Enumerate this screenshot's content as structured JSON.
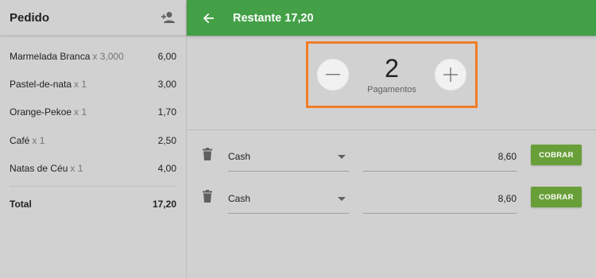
{
  "order": {
    "title": "Pedido",
    "items": [
      {
        "name": "Marmelada Branca",
        "qty": "x 3,000",
        "price": "6,00"
      },
      {
        "name": "Pastel-de-nata",
        "qty": "x 1",
        "price": "3,00"
      },
      {
        "name": "Orange-Pekoe",
        "qty": "x 1",
        "price": "1,70"
      },
      {
        "name": "Café",
        "qty": "x 1",
        "price": "2,50"
      },
      {
        "name": "Natas de Céu",
        "qty": "x 1",
        "price": "4,00"
      }
    ],
    "total_label": "Total",
    "total_value": "17,20"
  },
  "topbar": {
    "title": "Restante 17,20",
    "color": "#43a047"
  },
  "stepper": {
    "value": "2",
    "label": "Pagamentos",
    "highlight_color": "#f07e26"
  },
  "payments": [
    {
      "method": "Cash",
      "amount": "8,60",
      "button": "COBRAR"
    },
    {
      "method": "Cash",
      "amount": "8,60",
      "button": "COBRAR"
    }
  ],
  "icons": {
    "add_person": "person-add-icon",
    "back": "arrow-left-icon",
    "minus": "minus-icon",
    "plus": "plus-icon",
    "trash": "trash-icon",
    "dropdown": "caret-down-icon"
  },
  "colors": {
    "button": "#689f38",
    "background": "#d1d1d1"
  }
}
